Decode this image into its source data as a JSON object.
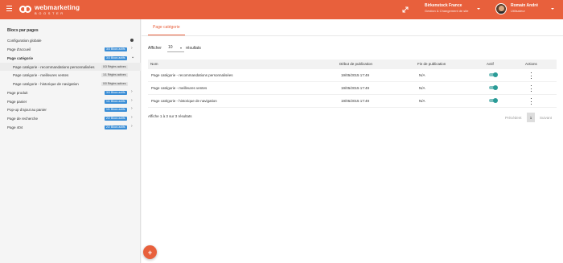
{
  "header": {
    "logo_line1": "webmarketing",
    "logo_line2": "BOOSTER",
    "store_name": "Birkenstock France",
    "store_sub": "Gestion & Changement de site",
    "user_name": "Romain André",
    "user_role": "Utilisateur",
    "accent": "#e8603c"
  },
  "sidebar": {
    "title": "Blocs par pages",
    "items": [
      {
        "label": "Configuration globale",
        "badge": ""
      },
      {
        "label": "Page d'accueil",
        "badge": "3/3 Blocs actifs"
      },
      {
        "label": "Page catégorie",
        "badge": "3/3 Blocs actifs"
      },
      {
        "label": "Page catégorie - recommandations personnalisées",
        "badge": "0/3 Règles actives"
      },
      {
        "label": "Page catégorie - meilleures ventes",
        "badge": "1/1 Règles actives"
      },
      {
        "label": "Page catégorie - historique de navigation",
        "badge": "0/0 Règles actives"
      },
      {
        "label": "Page produit",
        "badge": "3/3 Blocs actifs"
      },
      {
        "label": "Page panier",
        "badge": "1/1 Blocs actifs"
      },
      {
        "label": "Pop-up d'ajout au panier",
        "badge": "1/1 Blocs actifs"
      },
      {
        "label": "Page de recherche",
        "badge": "2/2 Blocs actifs"
      },
      {
        "label": "Page 404",
        "badge": "2/2 Blocs actifs"
      }
    ]
  },
  "main": {
    "tab": "Page catégorie",
    "show_label": "Afficher",
    "show_value": "10",
    "results_label": "résultats",
    "columns": [
      "Nom",
      "Début de publication",
      "Fin de publication",
      "Actif",
      "Actions"
    ],
    "rows": [
      {
        "name": "Page catégorie - recommandations personnalisées",
        "start": "19/05/2015 17:49",
        "end": "N/A",
        "active": true
      },
      {
        "name": "Page catégorie - meilleures ventes",
        "start": "19/05/2015 17:49",
        "end": "N/A",
        "active": true
      },
      {
        "name": "Page catégorie - historique de navigation",
        "start": "19/05/2015 17:49",
        "end": "N/A",
        "active": true
      }
    ],
    "info": "Affiche 1 à 3 sur 3 résultats",
    "pager_prev": "Précédent",
    "pager_current": "1",
    "pager_next": "Suivant",
    "fab_label": "+"
  }
}
